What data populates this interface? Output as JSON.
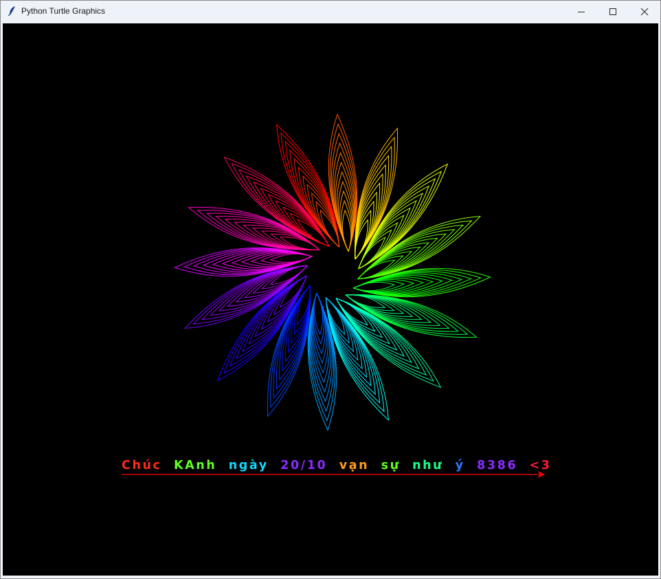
{
  "window": {
    "title": "Python Turtle Graphics",
    "controls": [
      "minimize",
      "maximize",
      "close"
    ]
  },
  "canvas": {
    "background": "#000000",
    "drawing": "rainbow spiral of 16 nested-outline petals",
    "greeting_segments": [
      {
        "text": "Chúc",
        "color": "#ff2a1a"
      },
      {
        "text": "  ",
        "color": "#000000"
      },
      {
        "text": "KAnh",
        "color": "#5cff24"
      },
      {
        "text": "  ",
        "color": "#000000"
      },
      {
        "text": "ngày",
        "color": "#10d8ff"
      },
      {
        "text": "  ",
        "color": "#000000"
      },
      {
        "text": "20/10",
        "color": "#8a2bff"
      },
      {
        "text": "  ",
        "color": "#000000"
      },
      {
        "text": "vạn",
        "color": "#ff9c1a"
      },
      {
        "text": "  ",
        "color": "#000000"
      },
      {
        "text": "sự",
        "color": "#5cff24"
      },
      {
        "text": "  ",
        "color": "#000000"
      },
      {
        "text": "như",
        "color": "#1aff8a"
      },
      {
        "text": "  ",
        "color": "#000000"
      },
      {
        "text": "ý",
        "color": "#2a7aff"
      },
      {
        "text": "  ",
        "color": "#000000"
      },
      {
        "text": "8386",
        "color": "#8a2bff"
      },
      {
        "text": "  ",
        "color": "#000000"
      },
      {
        "text": "<3",
        "color": "#ff1a3a"
      }
    ],
    "underline_arrow_color": "#ff0000"
  }
}
